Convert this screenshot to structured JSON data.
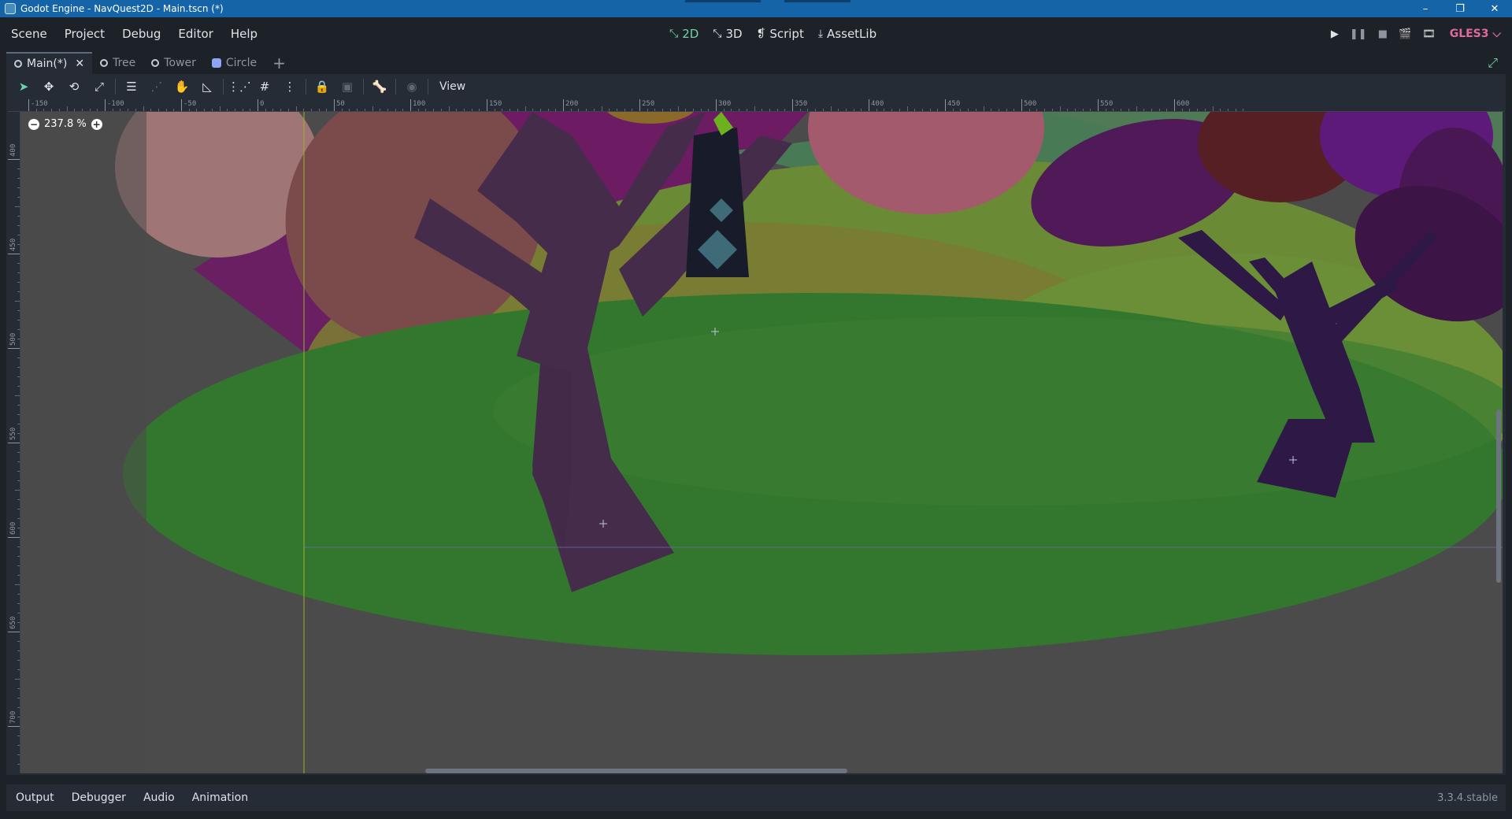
{
  "window": {
    "title": "Godot Engine - NavQuest2D - Main.tscn (*)",
    "controls": [
      "–",
      "❐",
      "✕"
    ]
  },
  "menus": [
    "Scene",
    "Project",
    "Debug",
    "Editor",
    "Help"
  ],
  "workspaces": [
    {
      "label": "2D",
      "glyph": "⤡",
      "active": true
    },
    {
      "label": "3D",
      "glyph": "⤡",
      "active": false
    },
    {
      "label": "Script",
      "glyph": "❡",
      "active": false
    },
    {
      "label": "AssetLib",
      "glyph": "⤓",
      "active": false
    }
  ],
  "run_controls": [
    "▶",
    "❚❚",
    "■",
    "🎬",
    "🎞"
  ],
  "renderer": "GLES3 ⌵",
  "scene_tabs": [
    {
      "label": "Main(*)",
      "icon": "circle-icon",
      "active": true,
      "closable": true
    },
    {
      "label": "Tree",
      "icon": "circle-icon",
      "active": false,
      "closable": false
    },
    {
      "label": "Tower",
      "icon": "circle-icon",
      "active": false,
      "closable": false
    },
    {
      "label": "Circle",
      "icon": "sprite-icon",
      "active": false,
      "closable": false
    }
  ],
  "tab_add": "+",
  "distraction_free_glyph": "⤢",
  "toolbar": {
    "tools": [
      {
        "name": "select-tool",
        "glyph": "➤",
        "state": "active"
      },
      {
        "name": "move-tool",
        "glyph": "✥",
        "state": "normal"
      },
      {
        "name": "rotate-tool",
        "glyph": "⟲",
        "state": "normal"
      },
      {
        "name": "scale-tool",
        "glyph": "⤢",
        "state": "normal"
      },
      {
        "sep": true
      },
      {
        "name": "list-select-tool",
        "glyph": "☰",
        "state": "normal"
      },
      {
        "name": "pivot-tool",
        "glyph": "⋰",
        "state": "dim"
      },
      {
        "name": "pan-tool",
        "glyph": "✋",
        "state": "normal"
      },
      {
        "name": "ruler-tool",
        "glyph": "◺",
        "state": "normal"
      },
      {
        "sep": true
      },
      {
        "name": "smart-snap-toggle",
        "glyph": "⋮⋰",
        "state": "normal"
      },
      {
        "name": "grid-snap-toggle",
        "glyph": "#",
        "state": "normal"
      },
      {
        "name": "snap-options",
        "glyph": "⋮",
        "state": "normal"
      },
      {
        "sep": true
      },
      {
        "name": "lock-toggle",
        "glyph": "🔒",
        "state": "dim"
      },
      {
        "name": "group-toggle",
        "glyph": "▣",
        "state": "dim"
      },
      {
        "sep": true
      },
      {
        "name": "skeleton-tool",
        "glyph": "🦴",
        "state": "normal"
      },
      {
        "sep": true
      },
      {
        "name": "camera-override",
        "glyph": "◉",
        "state": "dim"
      }
    ],
    "view_label": "View"
  },
  "viewport": {
    "zoom": "237.8 %",
    "zoom_out": "−",
    "zoom_in": "+",
    "ruler_h": [
      "-150",
      "-100",
      "-50",
      "0",
      "50",
      "100",
      "150",
      "200",
      "250",
      "300",
      "350",
      "400",
      "450",
      "500",
      "550",
      "600"
    ],
    "ruler_v": [
      "400",
      "450",
      "500",
      "550",
      "600",
      "650",
      "700"
    ]
  },
  "bottom_tabs": [
    "Output",
    "Debugger",
    "Audio",
    "Animation"
  ],
  "version": "3.3.4.stable",
  "colors": {
    "accent": "#6fd2a8",
    "titlebar": "#1564a8",
    "renderer": "#e06b9a"
  }
}
